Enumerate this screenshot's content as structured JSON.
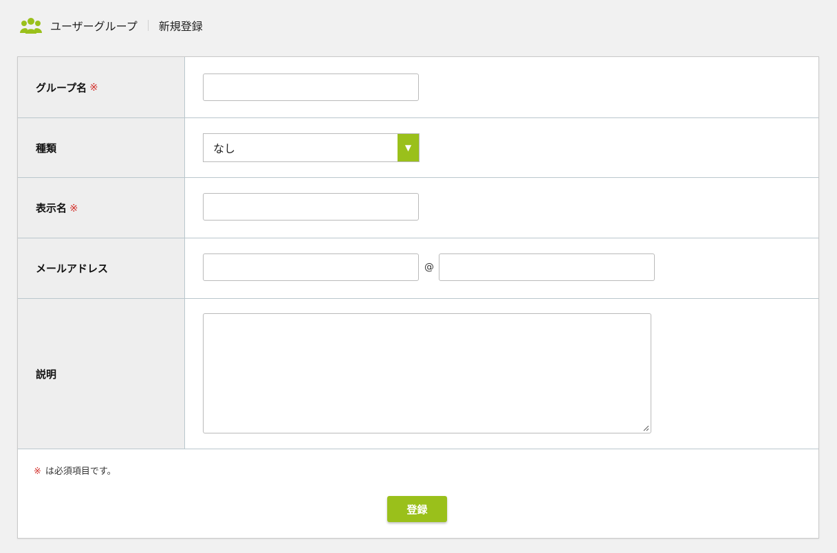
{
  "header": {
    "icon": "users-group-icon",
    "title": "ユーザーグループ",
    "subtitle": "新規登録"
  },
  "form": {
    "group_name_label": "グループ名",
    "type_label": "種類",
    "type_value": "なし",
    "display_name_label": "表示名",
    "email_label": "メールアドレス",
    "at_symbol": "@",
    "description_label": "説明",
    "required_mark": "※"
  },
  "footer": {
    "required_note_mark": "※",
    "required_note": "は必須項目です。",
    "submit_label": "登録"
  },
  "colors": {
    "accent": "#9ac01b",
    "required": "#d3312c"
  }
}
